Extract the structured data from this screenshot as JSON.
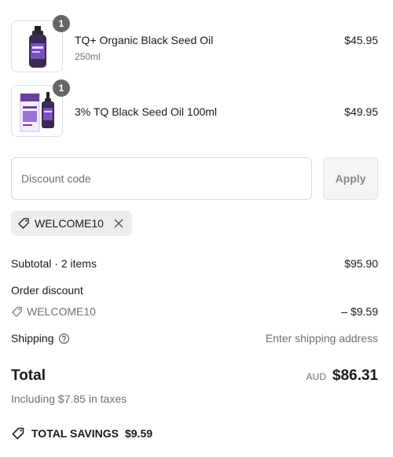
{
  "line_items": [
    {
      "quantity": "1",
      "name": "TQ+ Organic Black Seed Oil",
      "variant": "250ml",
      "price": "$45.95",
      "image": "black-seed-oil-bottle-icon"
    },
    {
      "quantity": "1",
      "name": "3% TQ Black Seed Oil 100ml",
      "variant": "",
      "price": "$49.95",
      "image": "black-seed-oil-box-and-bottle-icon"
    }
  ],
  "discount": {
    "placeholder": "Discount code",
    "value": "",
    "apply_label": "Apply",
    "applied_code": "WELCOME10"
  },
  "summary": {
    "subtotal_label": "Subtotal · 2 items",
    "subtotal_value": "$95.90",
    "order_discount_label": "Order discount",
    "order_discount_code": "WELCOME10",
    "order_discount_value": "– $9.59",
    "shipping_label": "Shipping",
    "shipping_value": "Enter shipping address"
  },
  "total": {
    "label": "Total",
    "currency": "AUD",
    "amount": "$86.31",
    "taxes_note": "Including $7.85 in taxes"
  },
  "savings": {
    "label": "TOTAL SAVINGS",
    "amount": "$9.59"
  },
  "colors": {
    "product_purple": "#6a3fa0",
    "badge_gray": "#666666",
    "muted_text": "#707070"
  }
}
